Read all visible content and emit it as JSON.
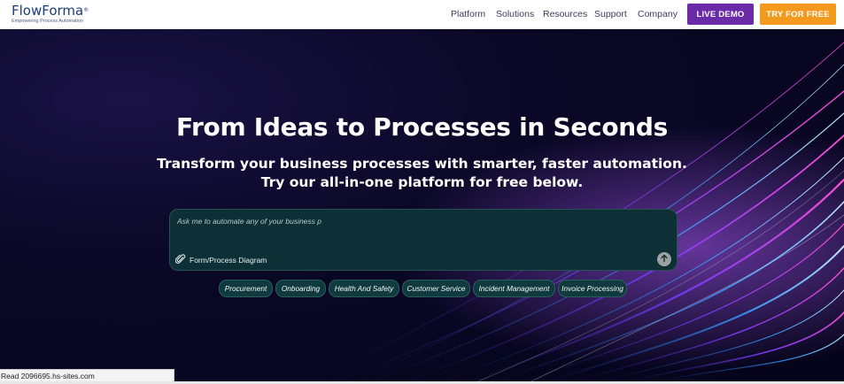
{
  "brand": {
    "name": "FlowForma",
    "reg": "®",
    "tagline": "Empowering Process Automation"
  },
  "nav": {
    "links": [
      "Platform",
      "Solutions",
      "Resources",
      "Support",
      "Company"
    ],
    "demo_label": "LIVE DEMO",
    "try_label": "TRY FOR FREE"
  },
  "colors": {
    "demo": "#6b2aa8",
    "try": "#f39a1e",
    "prompt_bg": "#0c3035",
    "chip_bg": "#0f3b3e"
  },
  "hero": {
    "headline": "From Ideas to Processes in Seconds",
    "sub_line1": "Transform your business processes with smarter, faster automation.",
    "sub_line2": "Try our all-in-one platform for free below."
  },
  "prompt": {
    "placeholder": "Ask me to automate any of your business p",
    "attach_label": "Form/Process Diagram",
    "attach_icon": "paperclip-icon",
    "send_icon": "arrow-up-icon"
  },
  "chips": [
    "Procurement",
    "Onboarding",
    "Health And Safety",
    "Customer Service",
    "Incident Management",
    "Invoice Processing"
  ],
  "status": {
    "text": "Read 2096695.hs-sites.com"
  }
}
